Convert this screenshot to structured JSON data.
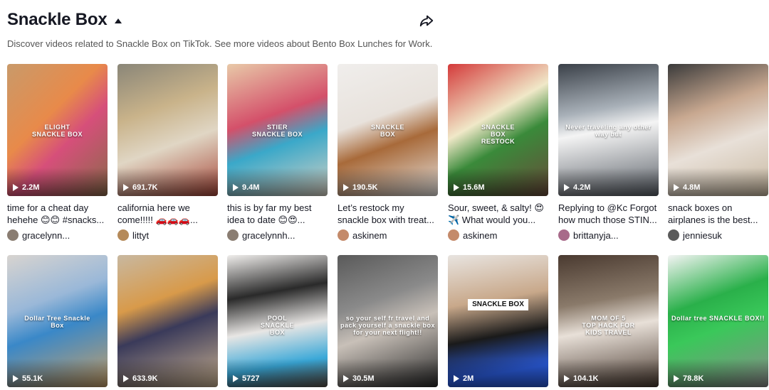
{
  "header": {
    "title": "Snackle Box",
    "description": "Discover videos related to Snackle Box on TikTok. See more videos about Bento Box Lunches for Work."
  },
  "videos": [
    {
      "views": "2.2M",
      "caption": "time for a cheat day hehehe 😊😊 #snacks...",
      "author": "gracelynn...",
      "overlay": "ELIGHT\nSNACKLE BOX",
      "bg": "linear-gradient(135deg,#c99a6a,#e88a4a 40%,#d64f7a 60%,#8a6a4a)",
      "avatar": "#8a7d72"
    },
    {
      "views": "691.7K",
      "caption": "california here we come!!!!! 🚗🚗🚗...",
      "author": "littyt",
      "overlay": "",
      "bg": "linear-gradient(160deg,#8a8678,#c9b38a 35%,#e0d6c4 60%,#a8483a)",
      "avatar": "#b58a5a"
    },
    {
      "views": "9.4M",
      "caption": "this is by far my best idea to date 😊😍...",
      "author": "gracelynnh...",
      "overlay": "STIER\nSNACKLE BOX",
      "bg": "linear-gradient(160deg,#e8c9a8,#d4506a 40%,#3aa8c9 60%,#d8d2c4)",
      "avatar": "#8a7d72"
    },
    {
      "views": "190.5K",
      "caption": "Let’s restock my snackle box with treat...",
      "author": "askinem",
      "overlay": "SNACKLE\nBOX",
      "bg": "linear-gradient(160deg,#f0eeec,#e8e2dc 40%,#a86a3a 60%,#e6e2de)",
      "avatar": "#c48a6a"
    },
    {
      "views": "15.6M",
      "caption": "Sour, sweet, & salty! 😍✈️ What would you...",
      "author": "askinem",
      "overlay": "SNACKLE\nBOX\nRESTOCK",
      "bg": "linear-gradient(150deg,#d43a3a,#f0e8c8 40%,#3a8a3a 60%,#6a4a3a)",
      "avatar": "#c48a6a"
    },
    {
      "views": "4.2M",
      "caption": "Replying to @Kc Forgot how much those STIN...",
      "author": "brittanyja...",
      "overlay": "Never traveling any other way but",
      "bg": "linear-gradient(170deg,#3a4048,#a8b0b8 35%,#f4f4f4 50%,#5a6068)",
      "avatar": "#a86a8a"
    },
    {
      "views": "4.8M",
      "caption": "snack boxes on airplanes is the best...",
      "author": "jenniesuk",
      "overlay": "",
      "bg": "linear-gradient(160deg,#3a3a3a,#c8a890 35%,#e8e0d8 60%,#c8b8a0)",
      "avatar": "#5a5a5a"
    },
    {
      "views": "55.1K",
      "caption": "",
      "author": "",
      "overlay": "Dollar Tree Snackle\nBox",
      "bg": "linear-gradient(160deg,#d8d4d0,#9ab8d8 35%,#3a88c8 55%,#c8a068)",
      "avatar": ""
    },
    {
      "views": "633.9K",
      "caption": "",
      "author": "",
      "overlay": "",
      "bg": "linear-gradient(160deg,#c8b8a0,#d89a4a 35%,#3a3a5a 55%,#c8b090)",
      "avatar": ""
    },
    {
      "views": "5727",
      "caption": "",
      "author": "",
      "overlay": "POOL\nSNACKLE\nBOX",
      "bg": "linear-gradient(170deg,#f0eeec,#2a2a2a 30%,#e8e6e4 55%,#3aa8d8 80%,#5a5048)",
      "avatar": ""
    },
    {
      "views": "30.5M",
      "caption": "",
      "author": "",
      "overlay": "so your self fr travel and pack yourself a snackle box for your next flight!!",
      "bg": "linear-gradient(160deg,#5a5a5a,#8a8a8a 35%,#c8c0b8 55%,#2a2a2a)",
      "avatar": ""
    },
    {
      "views": "2M",
      "caption": "",
      "author": "",
      "overlay": "SNACKLE BOX",
      "boxed": true,
      "bg": "linear-gradient(170deg,#e8e4e0,#c8a88a 35%,#1a1a1a 60%,#2a5ad8 85%)",
      "avatar": ""
    },
    {
      "views": "104.1K",
      "caption": "",
      "author": "",
      "overlay": "MOM OF 5\nTOP HACK FOR\nKIDS TRAVEL",
      "bg": "linear-gradient(170deg,#4a3a30,#8a7a6a 35%,#e8e0d8 55%,#4a3a30)",
      "avatar": ""
    },
    {
      "views": "78.8K",
      "caption": "",
      "author": "",
      "overlay": "Dollar tree SNACKLE BOX!!",
      "bg": "linear-gradient(160deg,#f4f4f4,#2ab04a 35%,#3ac85a 55%,#8a8a8a)",
      "avatar": ""
    }
  ]
}
